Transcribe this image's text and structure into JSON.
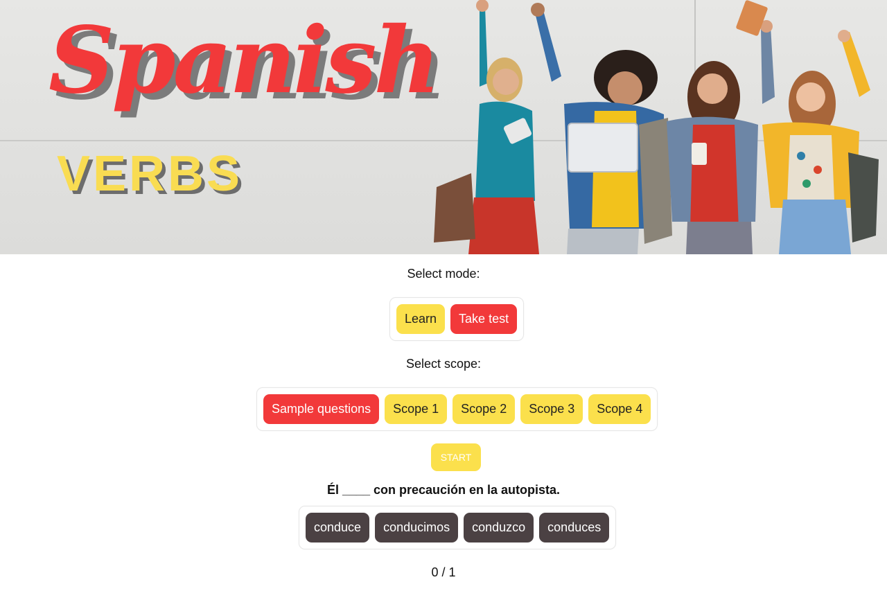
{
  "hero": {
    "title_script": "Spanish",
    "title_block": "VERBS"
  },
  "mode": {
    "label": "Select mode:",
    "options": [
      "Learn",
      "Take test"
    ],
    "selected": "Take test"
  },
  "scope": {
    "label": "Select scope:",
    "options": [
      "Sample questions",
      "Scope 1",
      "Scope 2",
      "Scope 3",
      "Scope 4"
    ],
    "selected": "Sample questions"
  },
  "start_label": "START",
  "question": {
    "text": "Él ____ con precaución en la autopista.",
    "answers": [
      "conduce",
      "conducimos",
      "conduzco",
      "conduces"
    ]
  },
  "score": "0 / 1",
  "colors": {
    "accent_red": "#f2393a",
    "accent_yellow": "#fbe04c",
    "answer_dark": "#4b4143"
  }
}
